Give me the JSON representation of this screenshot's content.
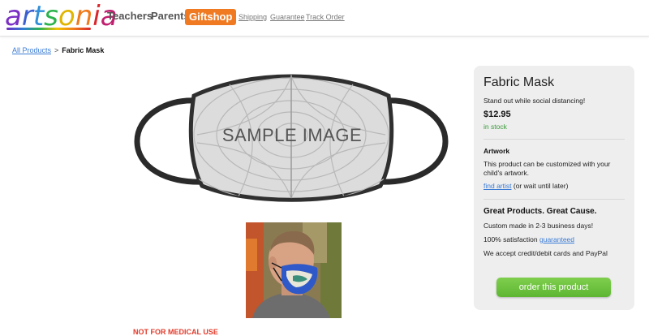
{
  "header": {
    "logo_text": "artsonia",
    "nav": {
      "teachers": "Teachers",
      "parents": "Parents",
      "giftshop": "Giftshop"
    },
    "links": {
      "shipping": "Shipping",
      "guarantee": "Guarantee",
      "track": "Track Order"
    }
  },
  "breadcrumb": {
    "root": "All Products",
    "separator": ">",
    "current": "Fabric Mask"
  },
  "product_image": {
    "overlay": "SAMPLE IMAGE"
  },
  "disclaimer": "NOT FOR MEDICAL USE",
  "panel": {
    "title": "Fabric Mask",
    "tagline": "Stand out while social distancing!",
    "price": "$12.95",
    "stock": "in stock",
    "artwork_heading": "Artwork",
    "artwork_text": "This product can be customized with your child's artwork.",
    "find_artist": "find artist",
    "wait_text": "(or wait until later)",
    "cause_heading": "Great Products. Great Cause.",
    "line1": "Custom made in 2-3 business days!",
    "line2": "100% satisfaction",
    "guaranteed": "guaranteed",
    "line3": "We accept credit/debit cards and PayPal",
    "button": "order this product"
  },
  "colors": {
    "accent_orange": "#f07a22",
    "button_green": "#6cc33f",
    "link_blue": "#3a7bd5",
    "stock_green": "#3a9a3a"
  },
  "icons": {
    "logo": "artsonia-logo"
  }
}
